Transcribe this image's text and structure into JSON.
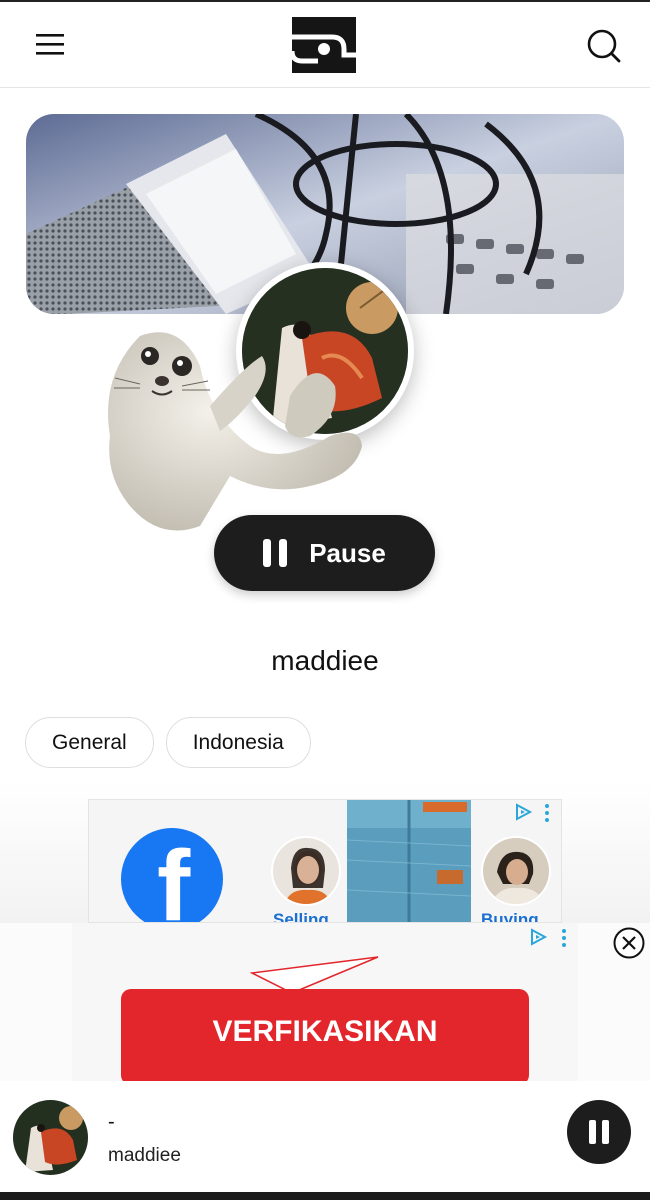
{
  "header": {
    "menu_icon": "hamburger-menu-icon",
    "logo_icon": "radio-logo-icon",
    "search_icon": "search-icon"
  },
  "station": {
    "name": "maddiee",
    "pause_label": "Pause",
    "tags": [
      "General",
      "Indonesia"
    ]
  },
  "ads": {
    "top_ad": {
      "captions": [
        "Selling",
        "Buying"
      ],
      "adchoices_icon": "adchoices-icon"
    },
    "overlay_ad": {
      "button_label": "VERFIKASIKAN",
      "close_icon": "close-circle-icon"
    }
  },
  "mini_player": {
    "track_title": "-",
    "station_name": "maddiee",
    "control_icon": "pause-icon"
  },
  "colors": {
    "button_dark": "#1d1d1d",
    "verify_red": "#e3262b",
    "facebook_blue": "#1877f2",
    "adchoices_blue": "#2aa7d8"
  }
}
